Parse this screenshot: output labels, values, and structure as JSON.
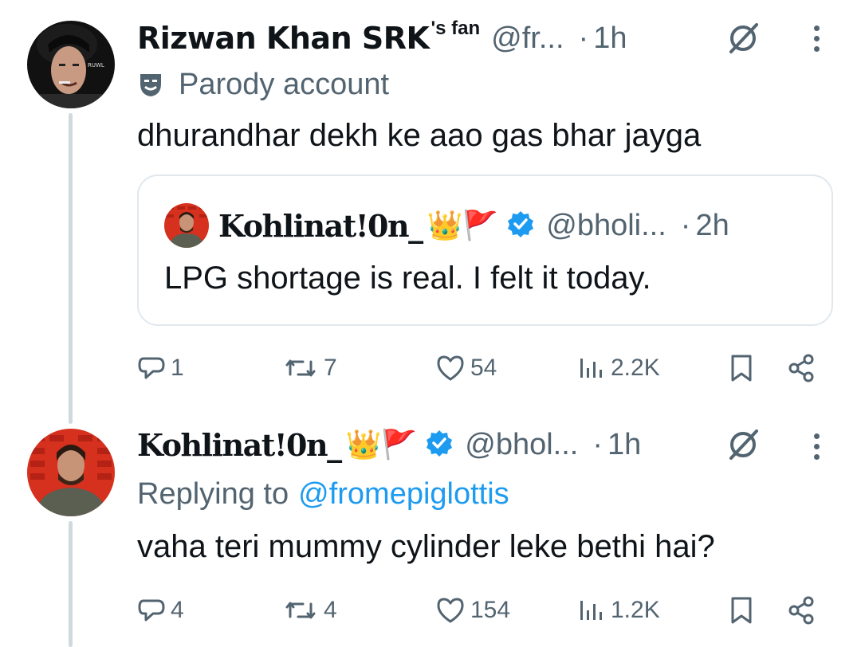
{
  "tweet1": {
    "name": "Rizwan Khan SRK",
    "name_sup": "'s fan",
    "handle": "@fr...",
    "time": "1h",
    "label_text": "Parody account",
    "text": "dhurandhar dekh ke aao gas bhar jayga",
    "quote": {
      "name": "Kohlinat!0n_",
      "emojis": "👑🚩",
      "handle": "@bholi...",
      "time": "2h",
      "text": "LPG shortage is real. I felt it today."
    },
    "actions": {
      "replies": "1",
      "reposts": "7",
      "likes": "54",
      "views": "2.2K"
    }
  },
  "tweet2": {
    "name": "Kohlinat!0n_",
    "emojis": "👑🚩",
    "handle": "@bhol...",
    "time": "1h",
    "replying_prefix": "Replying to",
    "replying_handle": "@fromepiglottis",
    "text": "vaha teri mummy cylinder leke bethi hai?",
    "actions": {
      "replies": "4",
      "reposts": "4",
      "likes": "154",
      "views": "1.2K"
    }
  },
  "separator": "·",
  "colors": {
    "text": "#0f1419",
    "muted": "#536471",
    "link": "#1d9bf0",
    "border": "#e1e8ed",
    "thread_line": "#cfd9de"
  }
}
